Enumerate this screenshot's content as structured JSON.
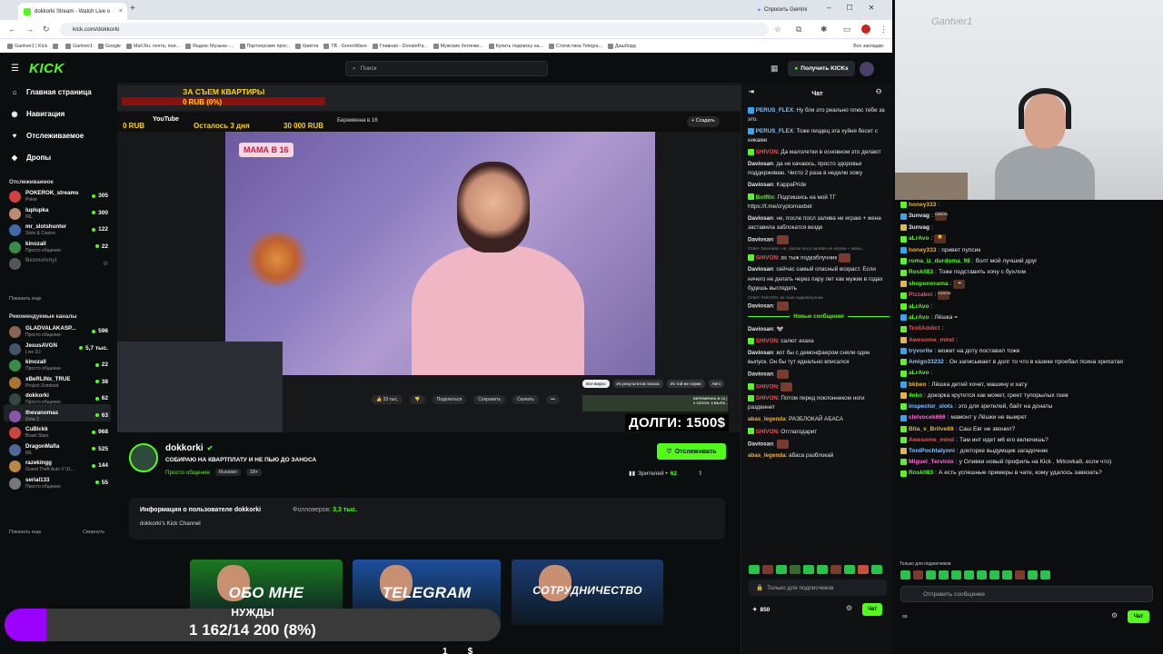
{
  "browser": {
    "tab_title": "dokkorki Stream - Watch Live o",
    "new_tab": "+",
    "gemini": "Спросить Gemini",
    "url": "kick.com/dokkorki",
    "bookmarks": [
      "Gantver1 | Kick",
      "",
      "Gantver1",
      "Google",
      "Mail.Ru: почта, пои...",
      "Яндекс Музыка -...",
      "Партнерские прог...",
      "Крипта",
      "TB - GreenWave",
      "Главная - DonatePa...",
      "Мужские ботинки...",
      "Купить подписку на...",
      "Статистика Telegra...",
      "Дашборд"
    ],
    "all_bookmarks": "Все закладки"
  },
  "header": {
    "logo": "KICK",
    "search_placeholder": "Поиск",
    "get_kicks": "Получить KICKs"
  },
  "nav": [
    {
      "label": "Главная страница",
      "icon": "home-icon",
      "glyph": "⌂"
    },
    {
      "label": "Навигация",
      "icon": "compass-icon",
      "glyph": "◉"
    },
    {
      "label": "Отслеживаемое",
      "icon": "heart-icon",
      "glyph": "♥"
    },
    {
      "label": "Дропы",
      "icon": "drops-icon",
      "glyph": "◆"
    }
  ],
  "following": {
    "title": "Отслеживаемое",
    "show_more": "Показать еще",
    "channels": [
      {
        "name": "POKEROK_streams",
        "cat": "Poker",
        "viewers": "305",
        "color": "#d04040"
      },
      {
        "name": "luplupka",
        "cat": "IRL",
        "viewers": "300",
        "color": "#c08a70"
      },
      {
        "name": "mr_slotshunter",
        "cat": "Slots & Casino",
        "viewers": "122",
        "color": "#4466aa"
      },
      {
        "name": "kinozall",
        "cat": "Просто общение",
        "viewers": "22",
        "color": "#3a8a4a"
      },
      {
        "name": "Bezmolvnyi",
        "cat": "",
        "viewers": "",
        "color": "#555555"
      }
    ]
  },
  "recommended": {
    "title": "Рекомендуемые каналы",
    "show_more": "Показать еще",
    "collapse": "Свернуть",
    "channels": [
      {
        "name": "GLADVALAKASP...",
        "cat": "Просто общение",
        "viewers": "596",
        "color": "#886655"
      },
      {
        "name": "JesusAVGN",
        "cat": "Live DJ",
        "viewers": "5,7 тыс.",
        "color": "#445566"
      },
      {
        "name": "kinozall",
        "cat": "Просто общение",
        "viewers": "22",
        "color": "#3a8a4a"
      },
      {
        "name": "xBeRLINx_TRUE",
        "cat": "Project Zomboid",
        "viewers": "38",
        "color": "#aa7733"
      },
      {
        "name": "dokkorki",
        "cat": "Просто общение",
        "viewers": "62",
        "color": "#2d4a3a"
      },
      {
        "name": "thevanomas",
        "cat": "Dota 2",
        "viewers": "63",
        "color": "#8855aa"
      },
      {
        "name": "CuBickk",
        "cat": "Brawl Stars",
        "viewers": "968",
        "color": "#cc4444"
      },
      {
        "name": "DragonMafia",
        "cat": "IRL",
        "viewers": "525",
        "color": "#556699"
      },
      {
        "name": "razekingg",
        "cat": "Grand Theft Auto V (G...",
        "viewers": "144",
        "color": "#bb8844"
      },
      {
        "name": "serial133",
        "cat": "Просто общение",
        "viewers": "55",
        "color": "#777777"
      }
    ]
  },
  "player": {
    "goal_title": "ЗА СЪЕМ КВАРТИРЫ",
    "goal_value": "0 RUB (0%)",
    "yt_left": "0 RUB",
    "yt_logo": "YouTube",
    "yt_remaining": "Осталось 3 дня",
    "yt_amount": "30 000 RUB",
    "yt_query": "Беременна в 16",
    "yt_create": "+ Создать",
    "video_badge": "МАМА В 16",
    "yt_actions": [
      "👍 33 тыс.",
      "👎",
      "Поделиться",
      "Сохранить",
      "Скачать",
      "•••"
    ],
    "yt_chips": [
      "Все видео",
      "Из результатов поиска",
      "Из той же серии",
      "Авто"
    ],
    "side_caption": "БЕРЕМЕННА В 16 | 2 СЕЗОН, 6 ВЫПУ...",
    "debts": "ДОЛГИ: 1500$"
  },
  "channel": {
    "name": "dokkorki",
    "title": "СОБИРАЮ НА КВАРТПЛАТУ И НЕ ПЬЮ ДО ЗАНОСА",
    "category": "Просто общение",
    "tags": [
      "Russian",
      "18+"
    ],
    "follow_label": "Отслеживать",
    "viewers_label": "Зрителей •",
    "viewers": "62"
  },
  "about": {
    "title": "Информация о пользователе dokkorki",
    "followers_label": "Фолловеров:",
    "followers": "3,3 тыс.",
    "desc": "dokkorki's Kick Channel"
  },
  "panels": [
    {
      "label": "ОБО МНЕ",
      "color": "#1a7a20"
    },
    {
      "label": "TELEGRAM",
      "color": "#1e4f9e"
    },
    {
      "label": "СОТРУДНИЧЕСТВО",
      "color": "#1a3a70"
    }
  ],
  "goal2": {
    "label": "НУЖДЫ",
    "value": "1 162/14 200 (8%)",
    "progress": 0.08
  },
  "bottom_cut": "1 ___ $",
  "chat": {
    "title": "Чат",
    "new_messages": "Новые сообщения",
    "sub_only": "Только для подписчиков",
    "points": "850",
    "chat_button": "Чат",
    "messages": [
      {
        "user": "PERUS_FLEX",
        "color": "#7fc4ff",
        "text": "Ну бля это реально плюс тебе за это.",
        "badge": "b"
      },
      {
        "user": "PERUS_FLEX",
        "color": "#7fc4ff",
        "text": "Тоже пиздец эта хуйня бесит с никами",
        "badge": "b"
      },
      {
        "user": "SHIVON",
        "color": "#ff4a4a",
        "text": "Да малолетки в основном это делают",
        "badge": "g"
      },
      {
        "user": "Daviosan",
        "color": "#e8e8e8",
        "text": "да не качаюсь, просто здоровье поддерживаю. Чисто 2 раза в неделю хожу"
      },
      {
        "user": "Daviosan",
        "color": "#e8e8e8",
        "text": "KappaPride"
      },
      {
        "user": "BotRix",
        "color": "#53fc18",
        "text": "Подпишись на мой ТГ https://t.me/cryptomaxbet",
        "badge": "g"
      },
      {
        "user": "Daviosan",
        "color": "#e8e8e8",
        "text": "не, после посл залива не играю + жена заставила заблокатся везде"
      },
      {
        "user": "Daviosan",
        "color": "#e8e8e8",
        "text": "",
        "emote": true
      },
      {
        "user": "SHIVON",
        "color": "#ff4a4a",
        "text": "ах тыж подкаблучник",
        "reply": "Ответ Daviosan: не, после посл залива не играю + жена...",
        "emote": true,
        "badge": "g"
      },
      {
        "user": "Daviosan",
        "color": "#e8e8e8",
        "text": "сейчас самый опасный возраст. Если ничего не делать через пару лет как мужик в годах будешь выглядеть"
      },
      {
        "user": "Daviosan",
        "color": "#e8e8e8",
        "text": "",
        "reply": "Ответ SHIVON: ах тыж подкаблучник",
        "emote": true
      },
      {
        "sep": true
      },
      {
        "user": "Daviosan",
        "color": "#e8e8e8",
        "text": "🐭"
      },
      {
        "user": "SHIVON",
        "color": "#ff4a4a",
        "text": "салют ахаха",
        "badge": "g"
      },
      {
        "user": "Daviosan",
        "color": "#e8e8e8",
        "text": "вот бы с демонфаером сняли один выпуск. Он бы тут идеально вписался"
      },
      {
        "user": "Daviosan",
        "color": "#e8e8e8",
        "text": "",
        "emote": true
      },
      {
        "user": "SHIVON",
        "color": "#ff4a4a",
        "text": "",
        "emote": true,
        "badge": "g"
      },
      {
        "user": "SHIVON",
        "color": "#ff4a4a",
        "text": "Потом перед поклонником ноги раздвинет",
        "badge": "g"
      },
      {
        "user": "abas_legenda",
        "color": "#e8b43a",
        "text": "РАЗБЛОКАЙ АБАСА"
      },
      {
        "user": "SHIVON",
        "color": "#ff4a4a",
        "text": "Отглагодарит",
        "badge": "g"
      },
      {
        "user": "SHIVON",
        "color": "#ff4a4a",
        "text": "Отглагодарит",
        "badge": "g",
        "reply": "Ответ SHIVON: Отглагодарит",
        "hidden": true
      },
      {
        "user": "Daviosan",
        "color": "#e8e8e8",
        "text": "",
        "emote": true
      },
      {
        "user": "abas_legenda",
        "color": "#e8b43a",
        "text": "абаса разблокай"
      }
    ]
  },
  "chat2": {
    "sub_only": "Только для подписчиков",
    "placeholder": "Отправить сообщение",
    "chat_button": "Чат",
    "infinity": "∞",
    "messages": [
      {
        "user": "honey333",
        "color": "#e8b43a",
        "text": ""
      },
      {
        "user": "3unvag",
        "color": "#e8e8e8",
        "text": "",
        "emote": "KANON"
      },
      {
        "user": "3unvag",
        "color": "#e8e8e8",
        "text": ""
      },
      {
        "user": "aLrAvo",
        "color": "#53fc18",
        "text": "",
        "emote": "😊"
      },
      {
        "user": "honey333",
        "color": "#e8b43a",
        "text": "привет пупсик"
      },
      {
        "user": "roma_iz_durdoma_98",
        "color": "#53fc18",
        "text": "болт мой лучший друг"
      },
      {
        "user": "RoskII83",
        "color": "#53fc18",
        "text": "Тоже подставить хочу с бухлом"
      },
      {
        "user": "shoponorama",
        "color": "#53fc18",
        "text": "",
        "emote": "☁"
      },
      {
        "user": "Pizzaboi",
        "color": "#ff4a4a",
        "text": "",
        "emote": "KANON"
      },
      {
        "user": "aLrAvo",
        "color": "#53fc18",
        "text": ""
      },
      {
        "user": "aLrAvo",
        "color": "#53fc18",
        "text": "Лёшка ="
      },
      {
        "user": "TrollAddict",
        "color": "#ff4a4a",
        "text": ""
      },
      {
        "user": "Awesome_mind",
        "color": "#ff4a4a",
        "text": ""
      },
      {
        "user": "tryvorite",
        "color": "#7fc4ff",
        "text": "может на доту поставил тоже"
      },
      {
        "user": "Amigo33232",
        "color": "#7fc4ff",
        "text": "Он записывает в долг то что в казике проебал псина хрипатая"
      },
      {
        "user": "aLrAvo",
        "color": "#53fc18",
        "text": ""
      },
      {
        "user": "bkben",
        "color": "#e8b43a",
        "text": "Лёшка детей хочет, машину и хату"
      },
      {
        "user": "4eko",
        "color": "#53fc18",
        "text": "докорка крутится как может, греет тупорылых гоев"
      },
      {
        "user": "inspector_slots",
        "color": "#7fc4ff",
        "text": "это для зрителей, байт на донаты"
      },
      {
        "user": "clelvocek666",
        "color": "#ff6bd6",
        "text": "мамонт у Лёшки не вымрет"
      },
      {
        "user": "Bita_v_Britve88",
        "color": "#e8b43a",
        "text": "Саш Евг не звонил?"
      },
      {
        "user": "Awesome_mind",
        "color": "#ff4a4a",
        "text": "Там инт идет м6 его включишь?"
      },
      {
        "user": "ToniPochtalyoni",
        "color": "#7fc4ff",
        "text": "докторке выдумщик загадочник"
      },
      {
        "user": "Miguel_Tervinio",
        "color": "#ff6bd6",
        "text": "у Оливки новый профиль на Kick , Mrkovka8, если что)"
      },
      {
        "user": "RoskII83",
        "color": "#53fc18",
        "text": "А есть успешные примеры в чате, кому удалось завязать?"
      }
    ]
  },
  "webcam": {
    "watermark": "Gantver1"
  }
}
